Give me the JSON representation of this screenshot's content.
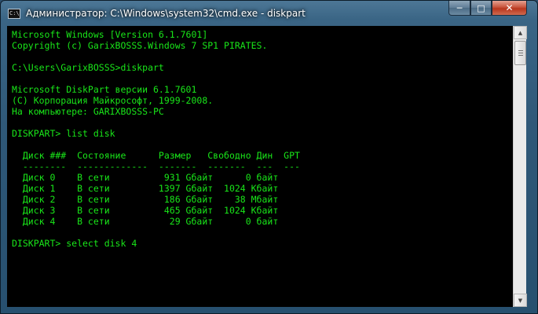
{
  "window": {
    "title": "Администратор: C:\\Windows\\system32\\cmd.exe - diskpart",
    "icon_text": "C:\\",
    "controls": {
      "minimize": "─",
      "maximize": "□",
      "close": "✕"
    }
  },
  "console": {
    "lines": [
      "Microsoft Windows [Version 6.1.7601]",
      "Copyright (c) GarixBOSSS.Windows 7 SP1 PIRATES.",
      "",
      "C:\\Users\\GarixBOSSS>diskpart",
      "",
      "Microsoft DiskPart версии 6.1.7601",
      "(C) Корпорация Майкрософт, 1999-2008.",
      "На компьютере: GARIXBOSSS-PC",
      "",
      "DISKPART> list disk",
      "",
      "  Диск ###  Состояние      Размер   Свободно Дин  GPT",
      "  --------  -------------  -------  -------  ---  ---",
      "  Диск 0    В сети          931 Gбайт      0 байт",
      "  Диск 1    В сети         1397 Gбайт  1024 Kбайт",
      "  Диск 2    В сети          186 Gбайт    38 Mбайт",
      "  Диск 3    В сети          465 Gбайт  1024 Kбайт",
      "  Диск 4    В сети           29 Gбайт      0 байт",
      "",
      "DISKPART> select disk 4"
    ]
  },
  "colors": {
    "console_bg": "#000000",
    "console_text": "#19e619"
  }
}
